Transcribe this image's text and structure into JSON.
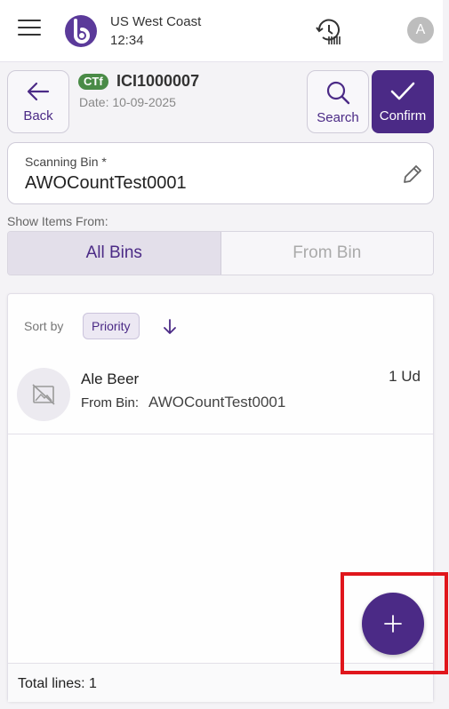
{
  "topbar": {
    "timezone": "US West Coast",
    "time": "12:34",
    "avatar_initial": "A",
    "icons": [
      "menu-icon",
      "app-logo",
      "history-barcode-icon"
    ]
  },
  "header": {
    "back_label": "Back",
    "badge": "CTf",
    "doc_id": "ICI1000007",
    "date": "Date: 10-09-2025",
    "search_label": "Search",
    "confirm_label": "Confirm"
  },
  "scan_bin": {
    "label": "Scanning Bin *",
    "value": "AWOCountTest0001"
  },
  "show_items": {
    "label": "Show Items From:",
    "options": [
      "All Bins",
      "From Bin"
    ],
    "selected": "All Bins"
  },
  "list": {
    "sort_label": "Sort by",
    "sort_field": "Priority",
    "sort_direction": "descending",
    "items": [
      {
        "name": "Ale Beer",
        "bin_label": "From Bin:",
        "bin_value": "AWOCountTest0001",
        "qty": "1 Ud"
      }
    ],
    "footer": "Total lines: 1"
  },
  "colors": {
    "primary": "#4b2a86",
    "badge_green": "#4a8b47",
    "highlight_red": "#e0161c"
  }
}
